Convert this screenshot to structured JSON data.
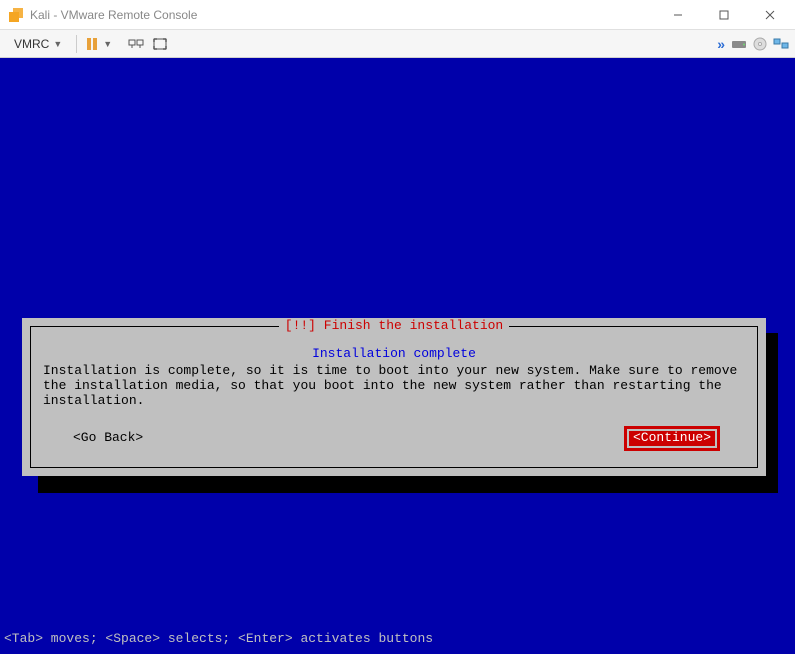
{
  "titlebar": {
    "title": "Kali - VMware Remote Console"
  },
  "toolbar": {
    "vmrc_label": "VMRC"
  },
  "dialog": {
    "frame_title": "[!!] Finish the installation",
    "heading": "Installation complete",
    "body": "Installation is complete, so it is time to boot into your new system. Make sure to remove the installation media, so that you boot into the new system rather than restarting the installation.",
    "go_back": "<Go Back>",
    "continue": "<Continue>"
  },
  "hint": "<Tab> moves; <Space> selects; <Enter> activates buttons"
}
